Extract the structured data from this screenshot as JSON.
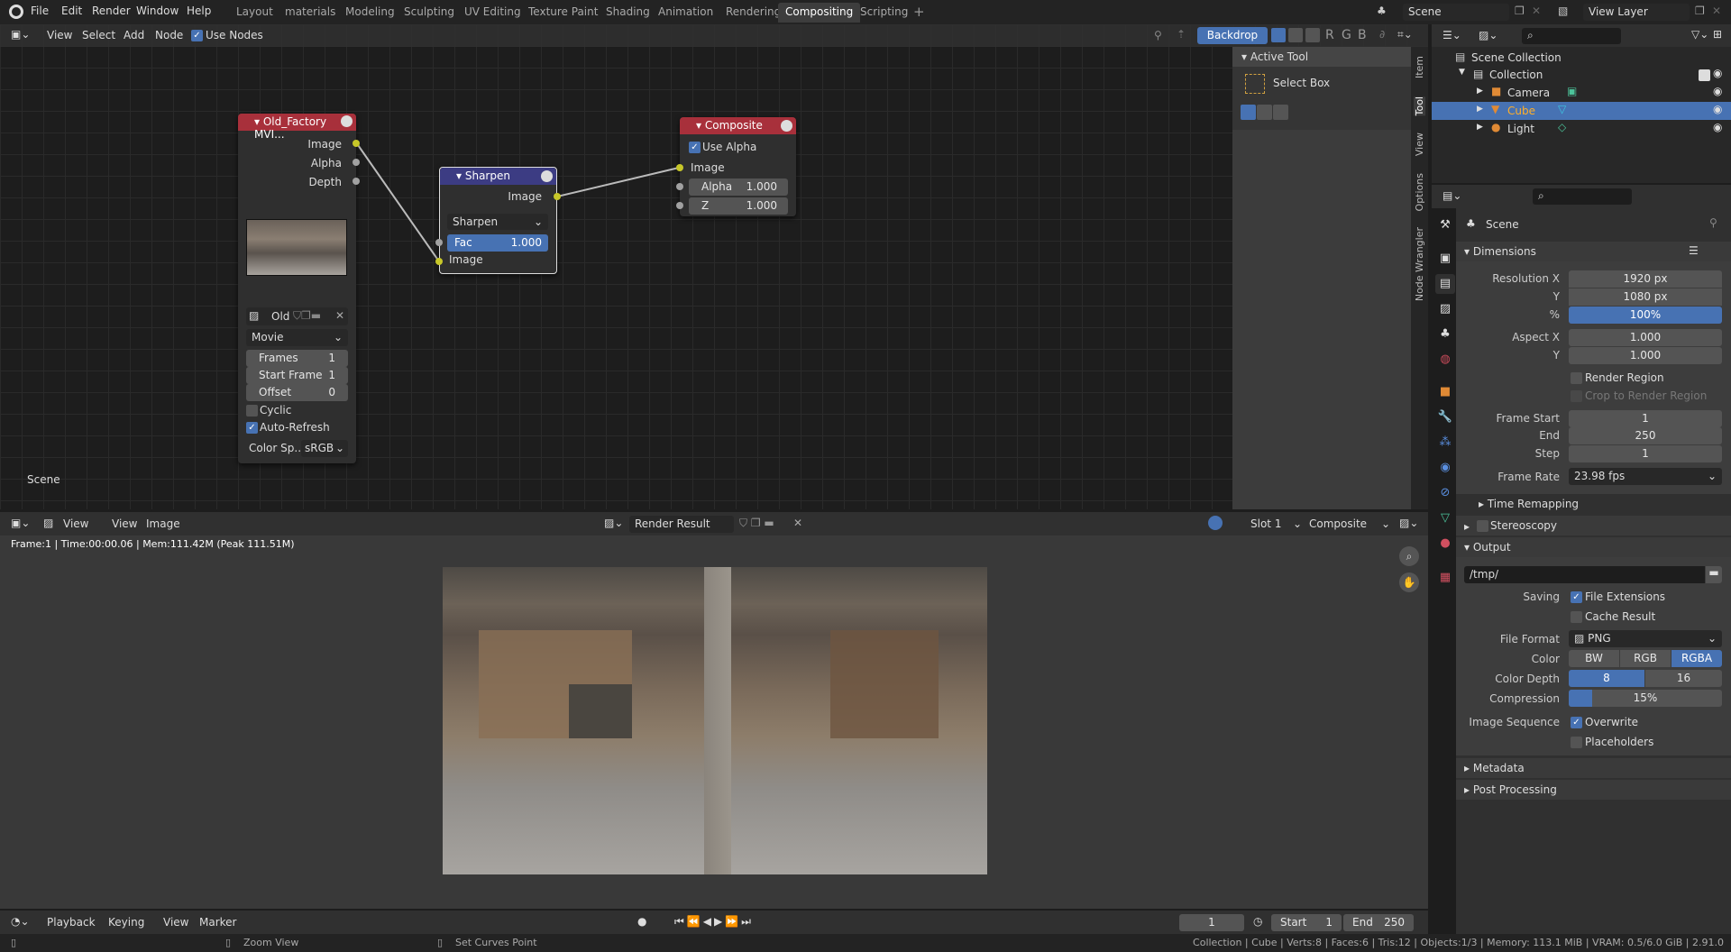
{
  "menus": [
    "File",
    "Edit",
    "Render",
    "Window",
    "Help"
  ],
  "workspaces": [
    "Layout",
    "materials",
    "Modeling",
    "Sculpting",
    "UV Editing",
    "Texture Paint",
    "Shading",
    "Animation",
    "Rendering",
    "Compositing",
    "Scripting"
  ],
  "active_workspace": "Compositing",
  "scene": "Scene",
  "view_layer": "View Layer",
  "node_header": {
    "menus": [
      "View",
      "Select",
      "Add",
      "Node"
    ],
    "use_nodes": "Use Nodes",
    "backdrop": "Backdrop",
    "channels": [
      "R",
      "G",
      "B"
    ]
  },
  "sidebar": {
    "panel": "Active Tool",
    "tool": "Select Box",
    "tabs": [
      "Item",
      "Tool",
      "View",
      "Options",
      "Node Wrangler"
    ]
  },
  "nodes": {
    "movie": {
      "title": "Old_Factory MVI...",
      "outputs": [
        "Image",
        "Alpha",
        "Depth"
      ],
      "image_name": "Old",
      "source": "Movie",
      "frames_label": "Frames",
      "frames": "1",
      "start_label": "Start Frame",
      "start": "1",
      "offset_label": "Offset",
      "offset": "0",
      "cyclic": "Cyclic",
      "auto_refresh": "Auto-Refresh",
      "colorspace_label": "Color Sp...",
      "colorspace": "sRGB"
    },
    "sharpen": {
      "title": "Sharpen",
      "output": "Image",
      "mode": "Sharpen",
      "fac_label": "Fac",
      "fac": "1.000",
      "input": "Image"
    },
    "composite": {
      "title": "Composite",
      "use_alpha": "Use Alpha",
      "image": "Image",
      "alpha_label": "Alpha",
      "alpha": "1.000",
      "z_label": "Z",
      "z": "1.000"
    }
  },
  "node_tree_label": "Scene",
  "image_editor": {
    "view": "View",
    "menus": [
      "View",
      "Image"
    ],
    "image": "Render Result",
    "slot": "Slot 1",
    "layer": "Composite",
    "info": "Frame:1 | Time:00:00.06 | Mem:111.42M (Peak 111.51M)"
  },
  "timeline": {
    "menus": [
      "Playback",
      "Keying",
      "View",
      "Marker"
    ],
    "current": "1",
    "start_label": "Start",
    "start": "1",
    "end_label": "End",
    "end": "250"
  },
  "status": {
    "left": "Zoom View",
    "mid": "Set Curves Point",
    "right": "Collection | Cube | Verts:8 | Faces:6 | Tris:12 | Objects:1/3 | Memory: 113.1 MiB | VRAM: 0.5/6.0 GiB | 2.91.0"
  },
  "outliner": {
    "root": "Scene Collection",
    "collection": "Collection",
    "items": [
      "Camera",
      "Cube",
      "Light"
    ],
    "selected": "Cube"
  },
  "properties": {
    "context": "Scene",
    "dimensions": {
      "title": "Dimensions",
      "res_x_label": "Resolution X",
      "res_x": "1920 px",
      "res_y_label": "Y",
      "res_y": "1080 px",
      "pct_label": "%",
      "pct": "100%",
      "aspect_x_label": "Aspect X",
      "aspect_x": "1.000",
      "aspect_y_label": "Y",
      "aspect_y": "1.000",
      "render_region": "Render Region",
      "crop": "Crop to Render Region",
      "frame_start_label": "Frame Start",
      "frame_start": "1",
      "end_label": "End",
      "end": "250",
      "step_label": "Step",
      "step": "1",
      "frame_rate_label": "Frame Rate",
      "frame_rate": "23.98 fps"
    },
    "time_remapping": "Time Remapping",
    "stereoscopy": "Stereoscopy",
    "output": {
      "title": "Output",
      "path": "/tmp/",
      "saving_label": "Saving",
      "file_ext": "File Extensions",
      "cache": "Cache Result",
      "format_label": "File Format",
      "format": "PNG",
      "color_label": "Color",
      "colors": [
        "BW",
        "RGB",
        "RGBA"
      ],
      "color_selected": "RGBA",
      "depth_label": "Color Depth",
      "depths": [
        "8",
        "16"
      ],
      "depth_selected": "8",
      "compression_label": "Compression",
      "compression": "15%",
      "compression_value": 15,
      "seq_label": "Image Sequence",
      "overwrite": "Overwrite",
      "placeholders": "Placeholders"
    },
    "metadata": "Metadata",
    "post_processing": "Post Processing"
  },
  "colors": {
    "accent": "#4772b3",
    "node_output": "#a8303b",
    "node_filter": "#3c3c83",
    "socket_image": "#c7c729",
    "selected_text": "#ffaf29"
  }
}
